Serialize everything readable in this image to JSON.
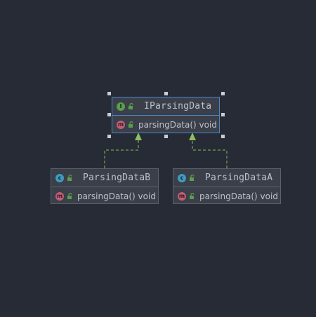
{
  "diagram": {
    "interface": {
      "name": "IParsingData",
      "kind_icon": "interface-icon",
      "kind_letter": "I",
      "member": {
        "kind_letter": "m",
        "text": "parsingData() void"
      }
    },
    "class_b": {
      "name": "ParsingDataB",
      "kind_icon": "class-icon",
      "kind_letter": "c",
      "member": {
        "kind_letter": "m",
        "text": "parsingData() void"
      }
    },
    "class_a": {
      "name": "ParsingDataA",
      "kind_icon": "class-icon",
      "kind_letter": "c",
      "member": {
        "kind_letter": "m",
        "text": "parsingData() void"
      }
    }
  },
  "colors": {
    "background": "#262b35",
    "box_fill": "#3a3f49",
    "selection": "#4a86c8",
    "interface_icon": "#5a9e4b",
    "class_icon": "#3e9bc0",
    "method_icon": "#c45c74",
    "edge": "#8bbf5f"
  }
}
